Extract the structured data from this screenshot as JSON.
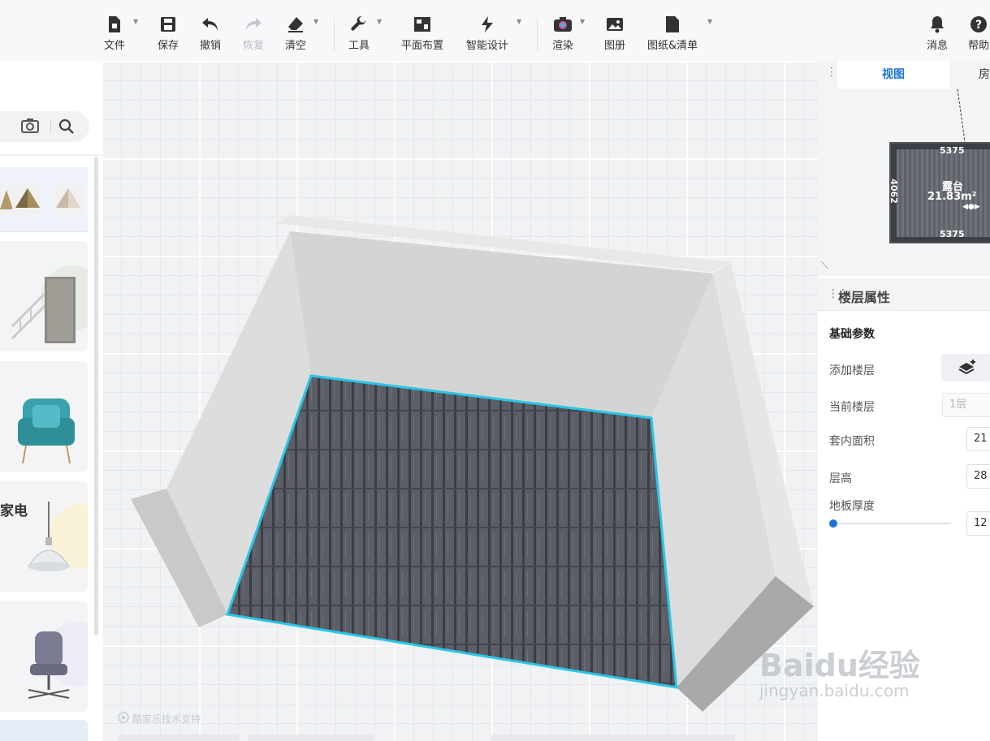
{
  "toolbar": {
    "file": "文件",
    "save": "保存",
    "undo": "撤销",
    "redo": "恢复",
    "clear": "清空",
    "tools": "工具",
    "floor_layout": "平面布置",
    "smart_design": "智能设计",
    "render": "渲染",
    "album": "图册",
    "drawings": "图纸&清单",
    "messages": "消息",
    "help": "帮助"
  },
  "left_panel": {
    "categories": [
      {
        "label": ""
      },
      {
        "label": ""
      },
      {
        "label": "家电"
      },
      {
        "label": ""
      }
    ]
  },
  "canvas": {
    "support_text": "酷家乐技术支持"
  },
  "right_panel": {
    "tabs": [
      "视图",
      "房"
    ],
    "minimap": {
      "room_name": "露台",
      "room_area": "21.83m²",
      "dim_top": "5375",
      "dim_bottom": "5375",
      "dim_left": "4062"
    },
    "title": "楼层属性",
    "section": "基础参数",
    "props": {
      "add_floor": "添加楼层",
      "current_floor": "当前楼层",
      "current_floor_value": "1层",
      "inner_area": "套内面积",
      "inner_area_value": "21",
      "floor_height": "层高",
      "floor_height_value": "28",
      "floor_thickness": "地板厚度",
      "floor_thickness_value": "12",
      "floor_thickness_slider": 0.03
    }
  },
  "watermark": {
    "brand": "Baidu经验",
    "url": "jingyan.baidu.com"
  },
  "colors": {
    "accent": "#1a73d8",
    "floor_outline": "#29c6e6",
    "wall": "#d9d9d9"
  }
}
